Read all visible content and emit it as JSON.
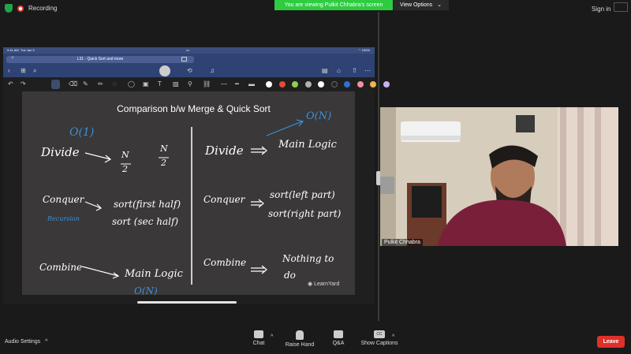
{
  "top": {
    "recording": "Recording",
    "share_banner": "You are viewing Pulkit Chhabra's screen",
    "view_options": "View Options",
    "sign_in": "Sign in"
  },
  "ipad": {
    "status_time": "9:41 AM",
    "status_date": "Tue Jan 9",
    "status_battery": "100%",
    "tab_title": "L31 - Quick Sort and more"
  },
  "board": {
    "title": "Comparison b/w Merge & Quick Sort",
    "left": {
      "complexity_top": "O(1)",
      "divide": "Divide",
      "n_half_1": "N",
      "n_half_1_den": "2",
      "n_half_2": "N",
      "n_half_2_den": "2",
      "conquer": "Conquer",
      "recursion": "Recursion",
      "sort_first": "sort(first half)",
      "sort_sec": "sort (sec half)",
      "combine": "Combine",
      "main_logic": "Main Logic",
      "complexity_bottom": "O(N)"
    },
    "right": {
      "complexity_top": "O(N)",
      "divide": "Divide",
      "main_logic": "Main Logic",
      "conquer": "Conquer",
      "sort_left": "sort(left part)",
      "sort_right": "sort(right part)",
      "combine": "Combine",
      "nothing": "Nothing to",
      "do": "do"
    },
    "logo": "LearnYard"
  },
  "camera": {
    "name": "Pulkit Chhabra"
  },
  "bottom": {
    "audio_settings": "Audio Settings",
    "chat": "Chat",
    "raise_hand": "Raise Hand",
    "qa": "Q&A",
    "show_captions": "Show Captions",
    "cc": "CC",
    "leave": "Leave"
  },
  "colors": {
    "banner": "#2ecc40",
    "leave": "#e0302a",
    "ink_blue": "#3c8fd6",
    "ipad_bar": "#2e4374"
  },
  "swatches": [
    "#ffffff",
    "#e24a3b",
    "#8cd052",
    "#b0b0b0",
    "#ffffff",
    "#222222",
    "#2f6fd6",
    "#f08fa2",
    "#f3b446",
    "#c6b0f0"
  ]
}
